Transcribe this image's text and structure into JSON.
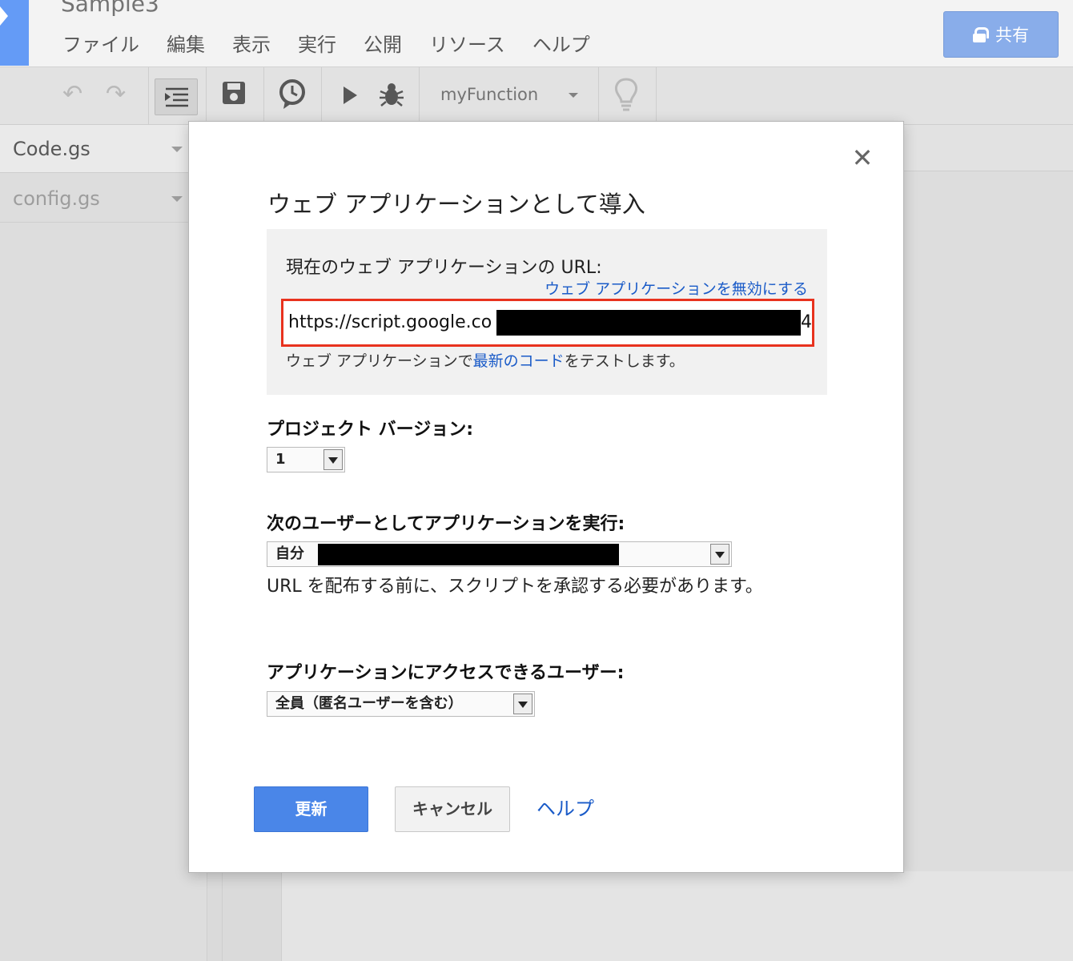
{
  "app": {
    "project_title": "Sample3",
    "menu": [
      "ファイル",
      "編集",
      "表示",
      "実行",
      "公開",
      "リソース",
      "ヘルプ"
    ],
    "share_label": "共有"
  },
  "toolbar": {
    "function_name": "myFunction",
    "icons": [
      "undo-icon",
      "redo-icon",
      "indent-icon",
      "save-icon",
      "triggers-icon",
      "run-icon",
      "debug-icon",
      "lightbulb-icon"
    ]
  },
  "files": [
    {
      "name": "Code.gs",
      "active": true
    },
    {
      "name": "config.gs",
      "active": false
    }
  ],
  "dialog": {
    "title": "ウェブ アプリケーションとして導入",
    "close_label": "✕",
    "current_url_label": "現在のウェブ アプリケーションの URL:",
    "disable_link": "ウェブ アプリケーションを無効にする",
    "url_visible_start": "https://script.google.co",
    "url_visible_end": "4",
    "test_prefix": "ウェブ アプリケーションで",
    "test_link": "最新のコード",
    "test_suffix": "をテストします。",
    "version_label": "プロジェクト バージョン:",
    "version_value": "1",
    "execute_as_label": "次のユーザーとしてアプリケーションを実行:",
    "execute_as_value": "自分",
    "authorize_note": "URL を配布する前に、スクリプトを承認する必要があります。",
    "access_label": "アプリケーションにアクセスできるユーザー:",
    "access_value": "全員（匿名ユーザーを含む）",
    "update_button": "更新",
    "cancel_button": "キャンセル",
    "help_link": "ヘルプ"
  },
  "colors": {
    "primary": "#4a86e8",
    "link": "#1a5bc8",
    "highlight_border": "#e8321e"
  }
}
